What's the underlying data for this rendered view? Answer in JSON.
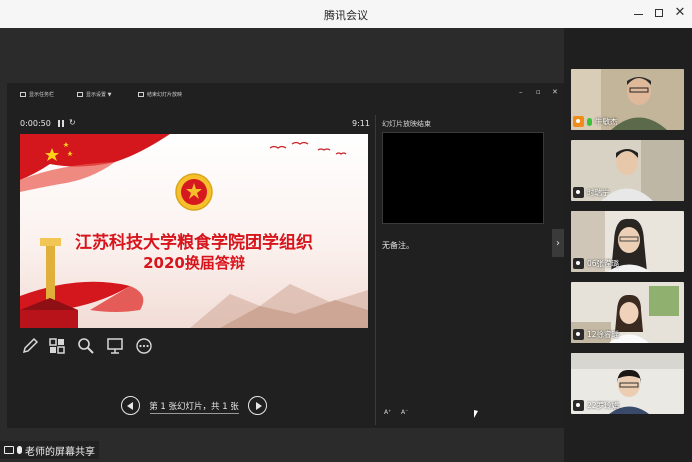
{
  "window": {
    "title": "腾讯会议"
  },
  "ppt_toolbar": {
    "items": [
      "显示任务栏",
      "显示设置 ▼",
      "结束幻灯片放映"
    ]
  },
  "presenter": {
    "elapsed": "0:00:50",
    "clock": "9:11",
    "next_slide_label": "幻灯片放映结束",
    "notes": "无备注。",
    "slide_counter": "第 1 张幻灯片，共 1 张",
    "font_increase": "A⁺",
    "font_decrease": "A⁻"
  },
  "slide": {
    "title_line1": "江苏科技大学粮食学院团学组织",
    "title_line2": "2020换届答辩"
  },
  "share_label": "老师的屏幕共享",
  "participants": [
    {
      "name": "牛敏杰",
      "camera_highlight": true,
      "mic_active": true
    },
    {
      "name": "时瑞宁",
      "camera_highlight": false,
      "mic_active": false
    },
    {
      "name": "06张滢璐",
      "camera_highlight": false,
      "mic_active": false
    },
    {
      "name": "12徐睿瑶",
      "camera_highlight": false,
      "mic_active": false
    },
    {
      "name": "22罗玲娟",
      "camera_highlight": false,
      "mic_active": false
    }
  ],
  "colors": {
    "slide_title_red": "#d8141c",
    "panel_dark": "#202020",
    "sidebar_dark": "#1f1f1f",
    "camera_on_orange": "#f08c1a",
    "mic_active_green": "#3ac13a"
  }
}
